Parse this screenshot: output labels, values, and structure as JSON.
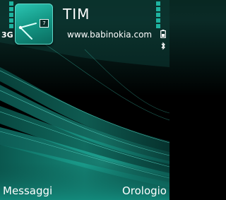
{
  "status": {
    "network_type": "3G",
    "operator_name": "TIM",
    "website": "www.babinokia.com"
  },
  "clock_widget": {
    "date": "7"
  },
  "softkeys": {
    "left": "Messaggi",
    "right": "Orologio"
  },
  "colors": {
    "teal": "#1aa593",
    "teal_light": "#4fe0cc",
    "background": "#000000"
  }
}
